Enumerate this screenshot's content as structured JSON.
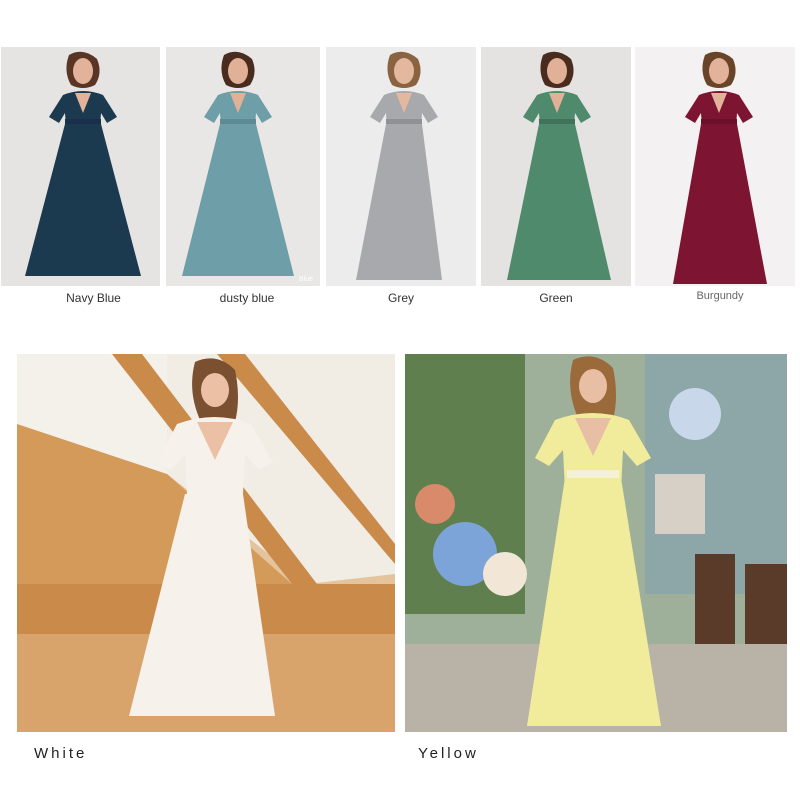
{
  "variants": [
    {
      "label": "Navy Blue",
      "color": "#1c3a4f",
      "background": "#e6e4e3"
    },
    {
      "label": "dusty blue",
      "color": "#6e9ea8",
      "background": "#e9e7e6",
      "tag": "Blue"
    },
    {
      "label": "Grey",
      "color": "#a8a9ac",
      "background": "#edecec"
    },
    {
      "label": "Green",
      "color": "#4f8a6c",
      "background": "#e5e3e2"
    },
    {
      "label": "Burgundy",
      "color": "#7d1532",
      "background": "#f3f1f1"
    }
  ],
  "featured": [
    {
      "label": "White",
      "color": "#f7f1ec",
      "background": "#c98a4a"
    },
    {
      "label": "Yellow",
      "color": "#f1ec9c",
      "background": "#6f8f5a"
    }
  ]
}
